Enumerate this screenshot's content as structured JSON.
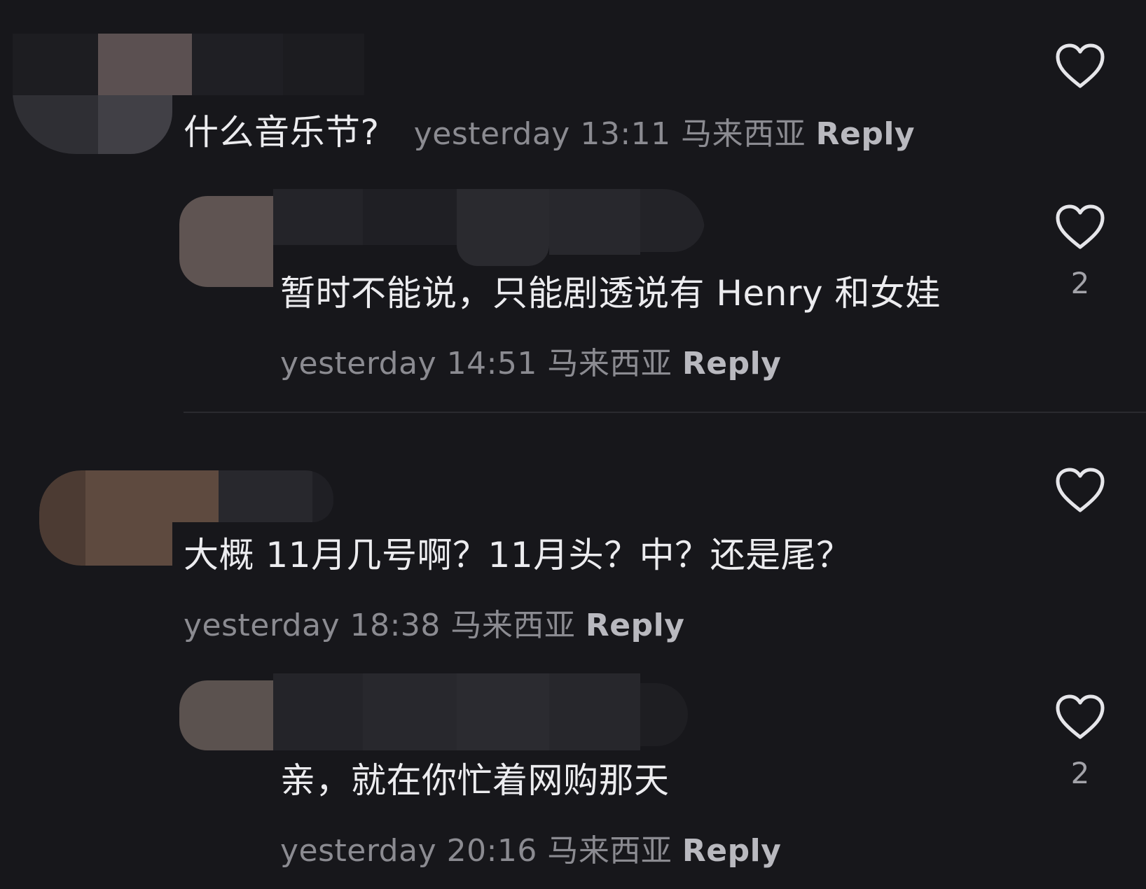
{
  "comments": [
    {
      "text": "什么音乐节?",
      "time": "yesterday 13:11",
      "location": "马来西亚",
      "reply": "Reply",
      "likes": ""
    },
    {
      "text": "暂时不能说，只能剧透说有 Henry 和女娃",
      "time": "yesterday 14:51",
      "location": "马来西亚",
      "reply": "Reply",
      "likes": "2"
    },
    {
      "text": "大概 11月几号啊？11月头？中？还是尾？",
      "time": "yesterday 18:38",
      "location": "马来西亚",
      "reply": "Reply",
      "likes": ""
    },
    {
      "text": "亲，就在你忙着网购那天",
      "time": "yesterday 20:16",
      "location": "马来西亚",
      "reply": "Reply",
      "likes": "2"
    }
  ],
  "icons": {
    "like": "heart-outline-icon"
  },
  "colors": {
    "background": "#17171b",
    "text": "#ececef",
    "meta": "#8b8b91",
    "reply": "#b9b9bf"
  }
}
